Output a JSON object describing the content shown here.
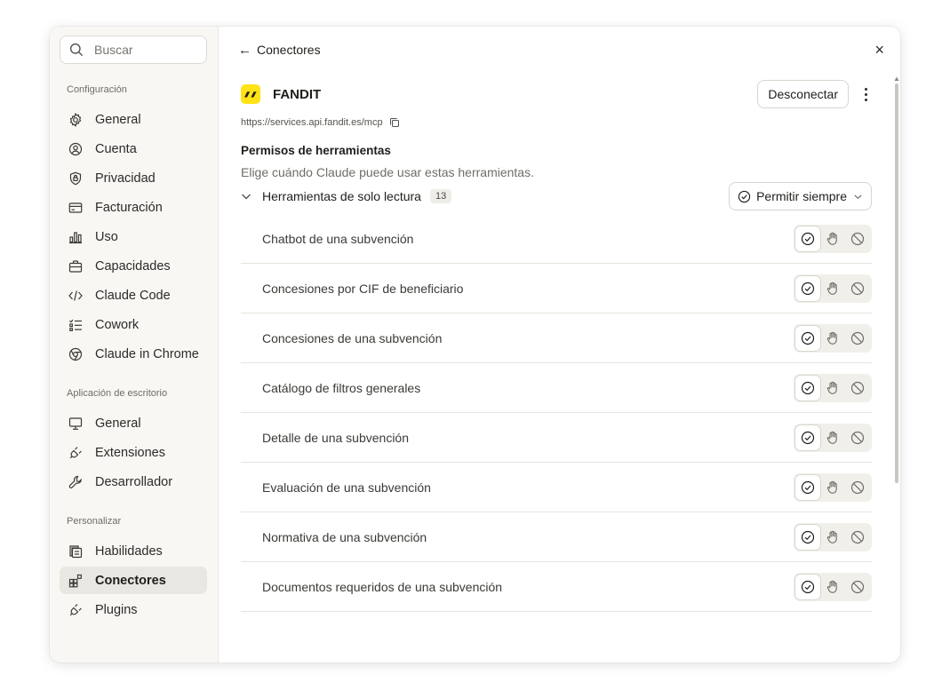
{
  "search": {
    "placeholder": "Buscar"
  },
  "sidebar": {
    "sections": [
      {
        "title": "Configuración",
        "items": [
          {
            "label": "General",
            "icon": "gear-icon"
          },
          {
            "label": "Cuenta",
            "icon": "account-icon"
          },
          {
            "label": "Privacidad",
            "icon": "privacy-lock-icon"
          },
          {
            "label": "Facturación",
            "icon": "billing-card-icon"
          },
          {
            "label": "Uso",
            "icon": "usage-bars-icon"
          },
          {
            "label": "Capacidades",
            "icon": "briefcase-icon"
          },
          {
            "label": "Claude Code",
            "icon": "code-icon"
          },
          {
            "label": "Cowork",
            "icon": "checklist-icon"
          },
          {
            "label": "Claude in Chrome",
            "icon": "chrome-icon"
          }
        ]
      },
      {
        "title": "Aplicación de escritorio",
        "items": [
          {
            "label": "General",
            "icon": "monitor-icon"
          },
          {
            "label": "Extensiones",
            "icon": "plug-icon"
          },
          {
            "label": "Desarrollador",
            "icon": "wrench-icon"
          }
        ]
      },
      {
        "title": "Personalizar",
        "items": [
          {
            "label": "Habilidades",
            "icon": "skills-icon"
          },
          {
            "label": "Conectores",
            "icon": "connectors-icon",
            "active": true
          },
          {
            "label": "Plugins",
            "icon": "plug-icon"
          }
        ]
      }
    ]
  },
  "topbar": {
    "back_label": "Conectores",
    "close_label": "×"
  },
  "connector": {
    "name": "FANDIT",
    "url": "https://services.api.fandit.es/mcp",
    "disconnect_label": "Desconectar",
    "logo_color": "#ffe316"
  },
  "permissions": {
    "title": "Permisos de herramientas",
    "subtitle": "Elige cuándo Claude puede usar estas herramientas.",
    "group": {
      "name": "Herramientas de solo lectura",
      "count": "13",
      "policy": "Permitir siempre"
    },
    "tools": [
      {
        "name": "Chatbot de una subvención"
      },
      {
        "name": "Concesiones por CIF de beneficiario"
      },
      {
        "name": "Concesiones de una subvención"
      },
      {
        "name": "Catálogo de filtros generales"
      },
      {
        "name": "Detalle de una subvención"
      },
      {
        "name": "Evaluación de una subvención"
      },
      {
        "name": "Normativa de una subvención"
      },
      {
        "name": "Documentos requeridos de una subvención"
      }
    ]
  },
  "colors": {
    "active_bg": "#e9e7e1",
    "sidebar_bg": "#f8f7f4",
    "logo_yellow": "#ffe316"
  }
}
